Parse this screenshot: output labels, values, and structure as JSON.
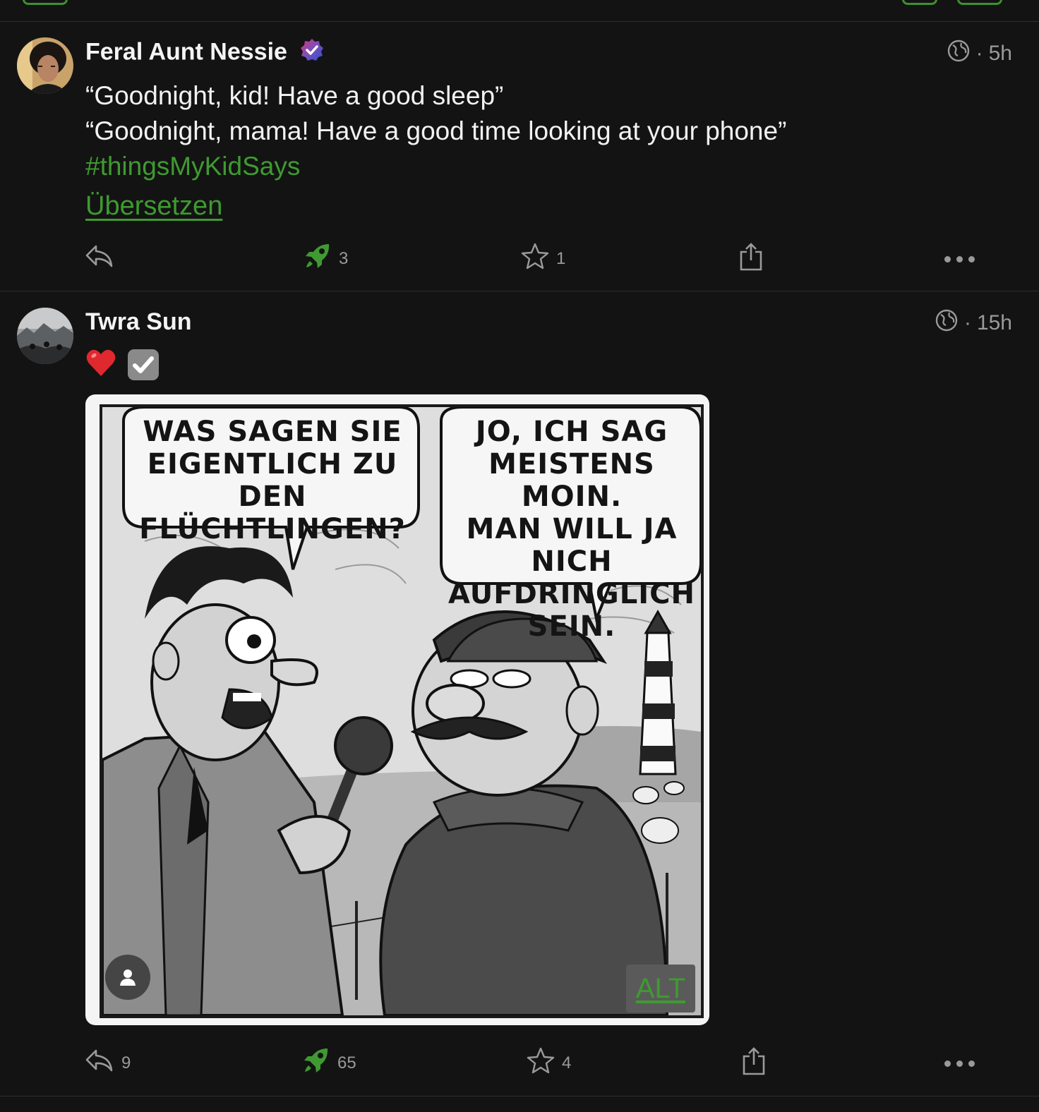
{
  "posts": [
    {
      "author": "Feral Aunt Nessie",
      "time": "5h",
      "separator": "·",
      "lines": [
        "“Goodnight, kid! Have a good sleep”",
        "“Goodnight, mama! Have a good time looking at your phone”"
      ],
      "hashtag": "#thingsMyKidSays",
      "translate_label": "Übersetzen",
      "counts": {
        "replies": "",
        "boosts": "3",
        "favourites": "1"
      }
    },
    {
      "author": "Twra Sun",
      "time": "15h",
      "separator": "·",
      "emojis": [
        "❤️",
        "✔"
      ],
      "media": {
        "left_bubble": "WAS SAGEN SIE\nEIGENTLICH ZU DEN\nFLÜCHTLINGEN?",
        "right_bubble": "JO, ICH SAG\nMEISTENS MOIN.\nMAN WILL JA NICH\nAUFDRINGLICH\nSEIN.",
        "alt_label": "ALT"
      },
      "counts": {
        "replies": "9",
        "boosts": "65",
        "favourites": "4"
      }
    }
  ],
  "colors": {
    "accent": "#3f9a31",
    "background": "#131313",
    "muted": "#9a9a9a"
  },
  "icons": [
    "reply-icon",
    "boost-rocket-icon",
    "star-icon",
    "share-icon",
    "more-icon",
    "globe-icon",
    "verified-badge-icon",
    "person-icon"
  ]
}
